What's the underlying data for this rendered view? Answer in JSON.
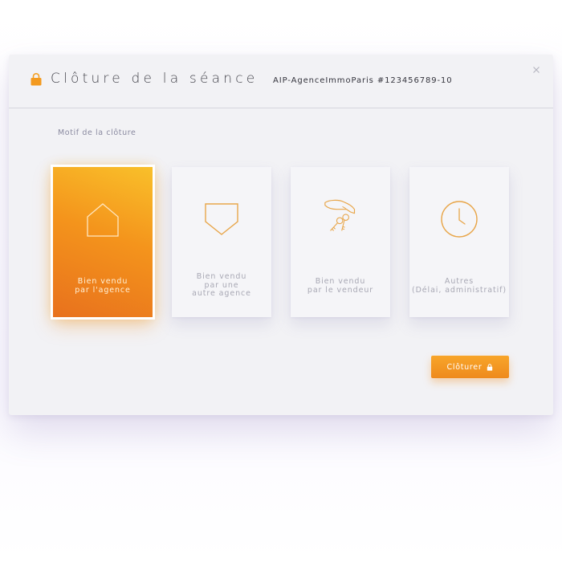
{
  "dialog": {
    "title": "Clôture de la séance",
    "session_id": "AIP-AgenceImmoParis #123456789-10",
    "close_icon": "close-icon",
    "title_icon": "lock-icon"
  },
  "form": {
    "reason_label": "Motif de la clôture",
    "options": [
      {
        "label": "Bien vendu\npar l'agence",
        "icon": "house-icon",
        "selected": true
      },
      {
        "label": "Bien vendu\npar une\nautre agence",
        "icon": "shield-icon",
        "selected": false
      },
      {
        "label": "Bien vendu\npar le vendeur",
        "icon": "hand-keys-icon",
        "selected": false
      },
      {
        "label": "Autres\n(Délai, administratif)",
        "icon": "clock-icon",
        "selected": false
      }
    ]
  },
  "actions": {
    "submit_label": "Clôturer",
    "submit_icon": "lock-icon"
  },
  "colors": {
    "accent": "#f39a1f",
    "accent_light": "#f9c02a",
    "accent_dark": "#e8711d",
    "icon_stroke": "#e8a64a",
    "panel_bg": "#f2f2f5",
    "muted_text": "#a8a8b4"
  }
}
